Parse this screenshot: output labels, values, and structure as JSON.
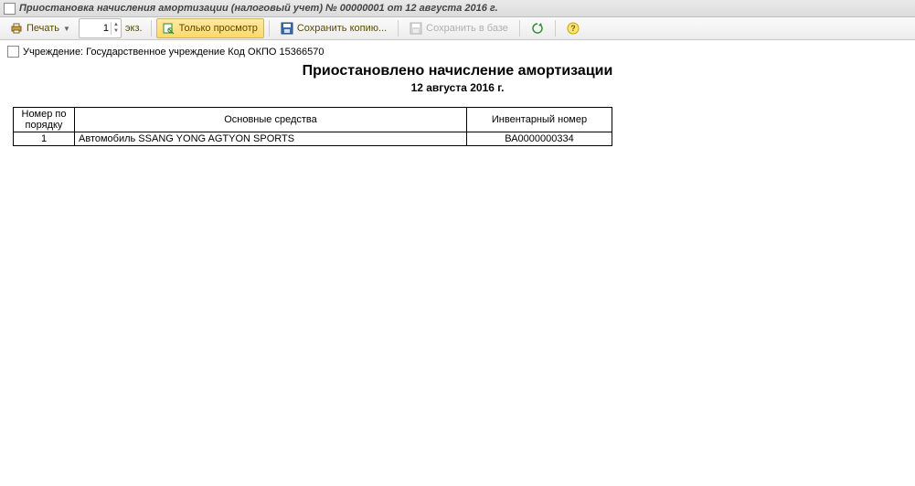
{
  "window": {
    "title": "Приостановка начисления амортизации (налоговый учет) № 00000001 от 12 августа 2016 г."
  },
  "toolbar": {
    "print_label": "Печать",
    "copies_value": "1",
    "copies_unit": "экз.",
    "preview_label": "Только просмотр",
    "save_copy_label": "Сохранить копию...",
    "save_db_label": "Сохранить в базе",
    "help_tooltip": "Справка"
  },
  "doc": {
    "org_line": "Учреждение: Государственное учреждение Код ОКПО 15366570",
    "title": "Приостановлено начисление амортизации",
    "date": "12 августа 2016 г."
  },
  "table": {
    "headers": {
      "no": "Номер по порядку",
      "asset": "Основные средства",
      "inv": "Инвентарный номер"
    },
    "rows": [
      {
        "no": "1",
        "asset": "Автомобиль SSANG YONG AGTYON SPORTS",
        "inv": "ВА0000000334"
      }
    ]
  }
}
